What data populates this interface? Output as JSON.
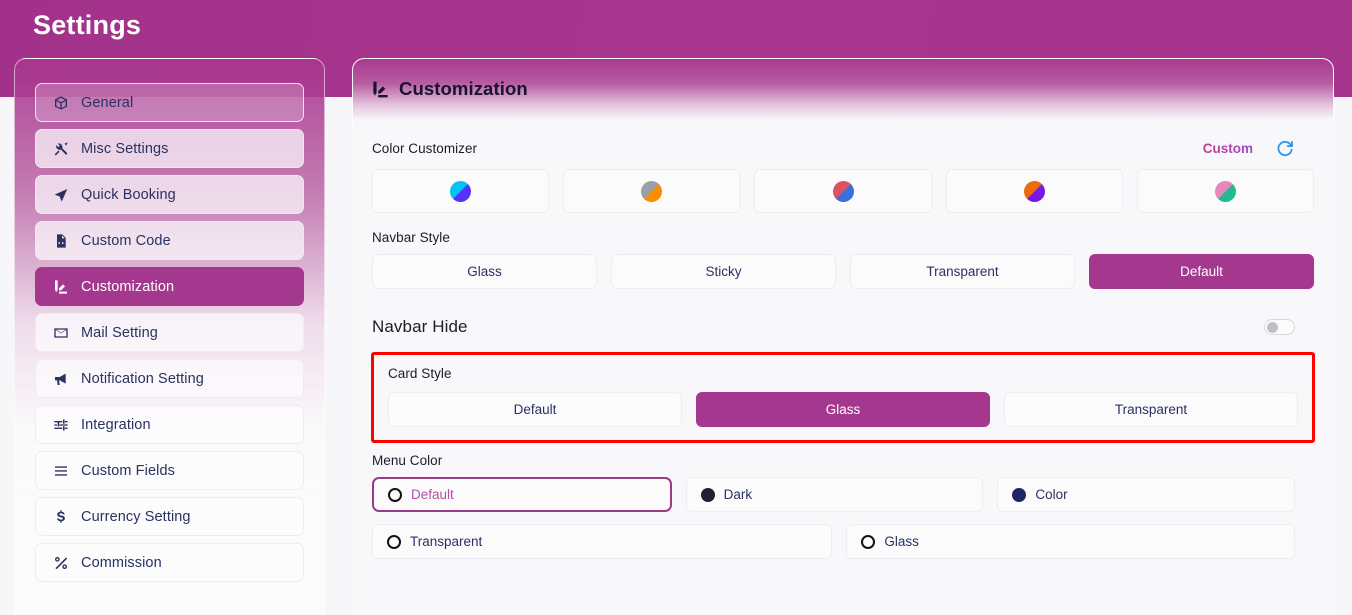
{
  "header": {
    "title": "Settings"
  },
  "sidebar": {
    "items": [
      {
        "label": "General",
        "icon": "cube-icon",
        "state": "top"
      },
      {
        "label": "Misc Settings",
        "icon": "tools-icon",
        "state": "normal"
      },
      {
        "label": "Quick Booking",
        "icon": "paper-plane-icon",
        "state": "normal"
      },
      {
        "label": "Custom Code",
        "icon": "file-code-icon",
        "state": "normal"
      },
      {
        "label": "Customization",
        "icon": "palette-icon",
        "state": "active"
      },
      {
        "label": "Mail Setting",
        "icon": "envelope-icon",
        "state": "normal"
      },
      {
        "label": "Notification Setting",
        "icon": "megaphone-icon",
        "state": "normal"
      },
      {
        "label": "Integration",
        "icon": "sliders-icon",
        "state": "normal"
      },
      {
        "label": "Custom Fields",
        "icon": "list-icon",
        "state": "normal"
      },
      {
        "label": "Currency Setting",
        "icon": "dollar-icon",
        "state": "normal"
      },
      {
        "label": "Commission",
        "icon": "percent-icon",
        "state": "normal"
      }
    ]
  },
  "main": {
    "panel_title": "Customization",
    "panel_icon": "palette-icon",
    "color_customizer": {
      "label": "Color Customizer",
      "custom_link": "Custom",
      "refresh_icon": "refresh-icon",
      "swatches": [
        {
          "name": "cyan-blue",
          "left": "#00c2f3",
          "right": "#5433ff"
        },
        {
          "name": "gray-orange",
          "left": "#9aa0ab",
          "right": "#fb8c00"
        },
        {
          "name": "red-blue",
          "left": "#d95362",
          "right": "#3a6fe0"
        },
        {
          "name": "orange-purple",
          "left": "#ed6a0c",
          "right": "#7619e8"
        },
        {
          "name": "pink-green",
          "left": "#e887be",
          "right": "#22bb8f"
        }
      ]
    },
    "navbar_style": {
      "label": "Navbar Style",
      "options": [
        "Glass",
        "Sticky",
        "Transparent",
        "Default"
      ],
      "selected": "Default"
    },
    "navbar_hide": {
      "label": "Navbar Hide",
      "enabled": false
    },
    "card_style": {
      "label": "Card Style",
      "options": [
        "Default",
        "Glass",
        "Transparent"
      ],
      "selected": "Glass",
      "highlight_color": "#ff0000"
    },
    "menu_color": {
      "label": "Menu Color",
      "options": [
        {
          "label": "Default",
          "dot": "ring",
          "selected": true
        },
        {
          "label": "Dark",
          "dot": "solid-dark",
          "selected": false
        },
        {
          "label": "Color",
          "dot": "solid-navy",
          "selected": false
        },
        {
          "label": "Transparent",
          "dot": "ring",
          "selected": false
        },
        {
          "label": "Glass",
          "dot": "ring",
          "selected": false
        }
      ]
    }
  },
  "colors": {
    "brand_purple": "#a3388e",
    "text_navy": "#2b3161",
    "page_bg": "#f7f7f9"
  }
}
